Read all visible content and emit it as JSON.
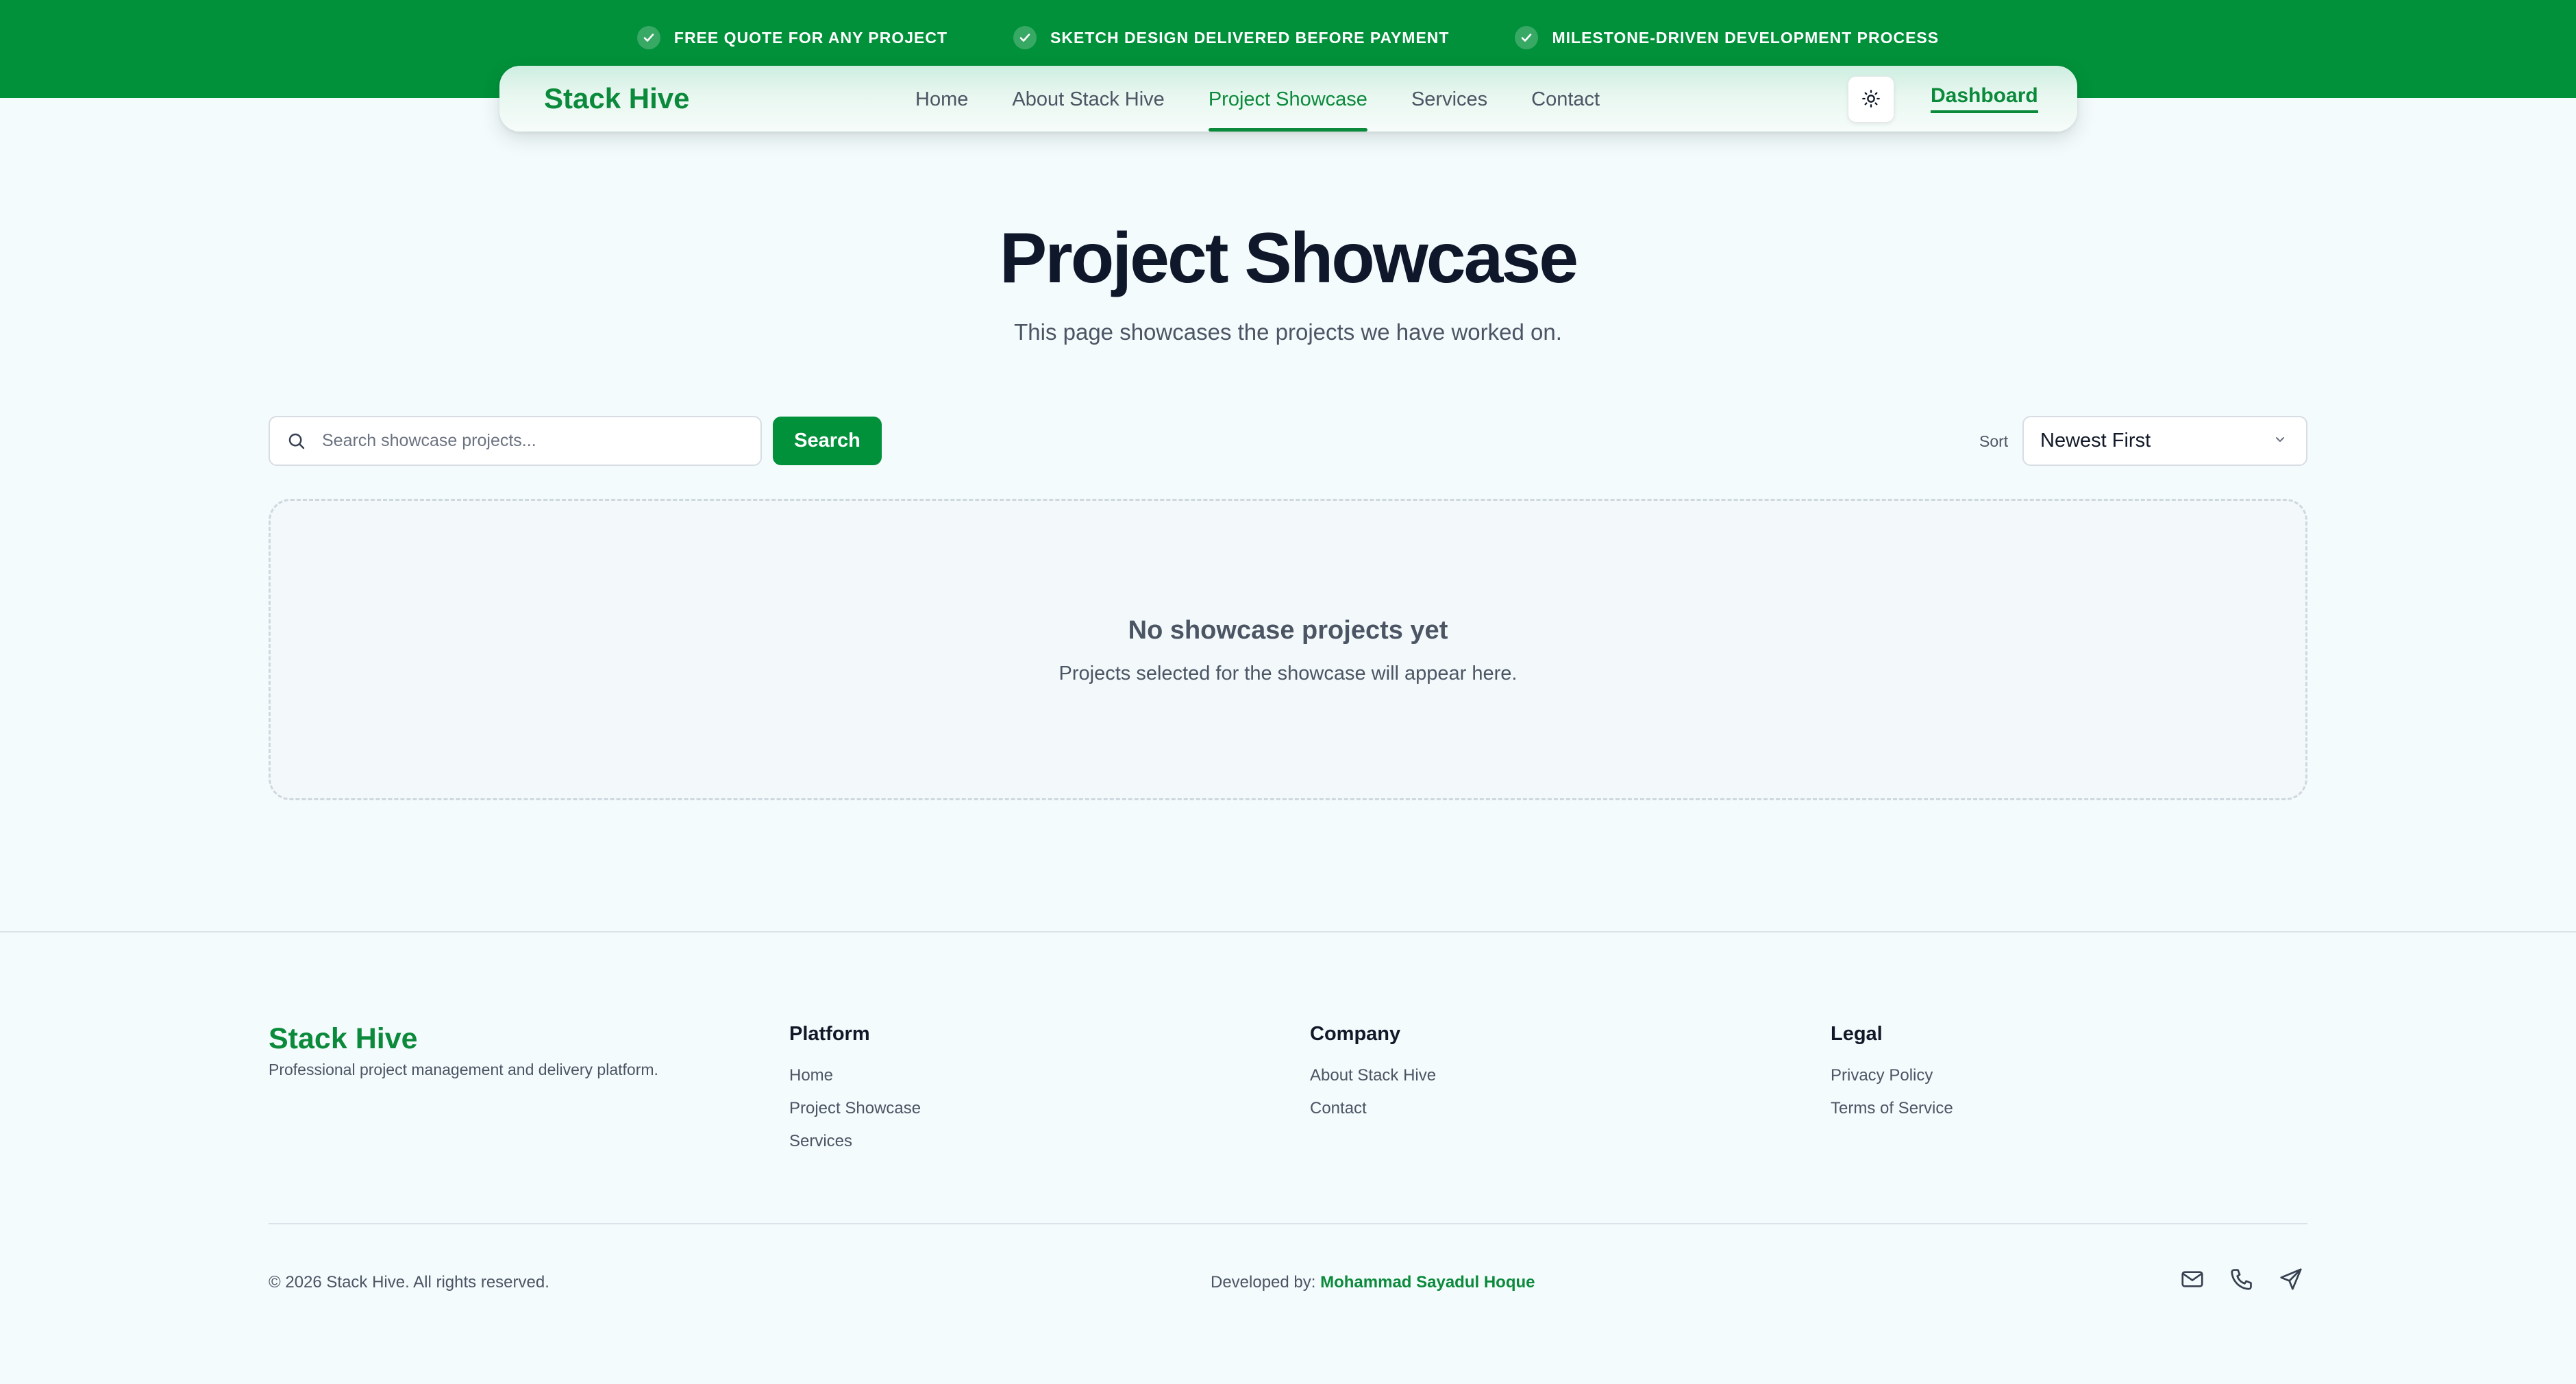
{
  "banner": {
    "items": [
      {
        "label": "FREE QUOTE FOR ANY PROJECT",
        "icon": "check-icon"
      },
      {
        "label": "SKETCH DESIGN DELIVERED BEFORE PAYMENT",
        "icon": "check-icon"
      },
      {
        "label": "MILESTONE-DRIVEN DEVELOPMENT PROCESS",
        "icon": "check-icon"
      }
    ],
    "background": "#00913a"
  },
  "nav": {
    "brand": "Stack Hive",
    "links": [
      {
        "label": "Home",
        "active": false
      },
      {
        "label": "About Stack Hive",
        "active": false
      },
      {
        "label": "Project Showcase",
        "active": true
      },
      {
        "label": "Services",
        "active": false
      },
      {
        "label": "Contact",
        "active": false
      }
    ],
    "theme_toggle_icon": "sun-icon",
    "dashboard_label": "Dashboard"
  },
  "hero": {
    "title": "Project Showcase",
    "subtitle": "This page showcases the projects we have worked on."
  },
  "toolbar": {
    "search_placeholder": "Search showcase projects...",
    "search_value": "",
    "search_button_label": "Search",
    "sort_label": "Sort",
    "sort_value": "Newest First"
  },
  "empty_state": {
    "title": "No showcase projects yet",
    "text": "Projects selected for the showcase will appear here."
  },
  "footer": {
    "brand": "Stack Hive",
    "tagline": "Professional project management and delivery platform.",
    "columns": [
      {
        "title": "Platform",
        "links": [
          "Home",
          "Project Showcase",
          "Services"
        ]
      },
      {
        "title": "Company",
        "links": [
          "About Stack Hive",
          "Contact"
        ]
      },
      {
        "title": "Legal",
        "links": [
          "Privacy Policy",
          "Terms of Service"
        ]
      }
    ],
    "copyright": "© 2026 Stack Hive. All rights reserved.",
    "developed_by_label": "Developed by:",
    "developer_name": "Mohammad Sayadul Hoque",
    "social_icons": [
      "mail-icon",
      "phone-icon",
      "send-icon"
    ]
  },
  "colors": {
    "brand_green": "#0a8a3a",
    "page_background": "#f4fbfd",
    "title_text": "#0f172a"
  }
}
